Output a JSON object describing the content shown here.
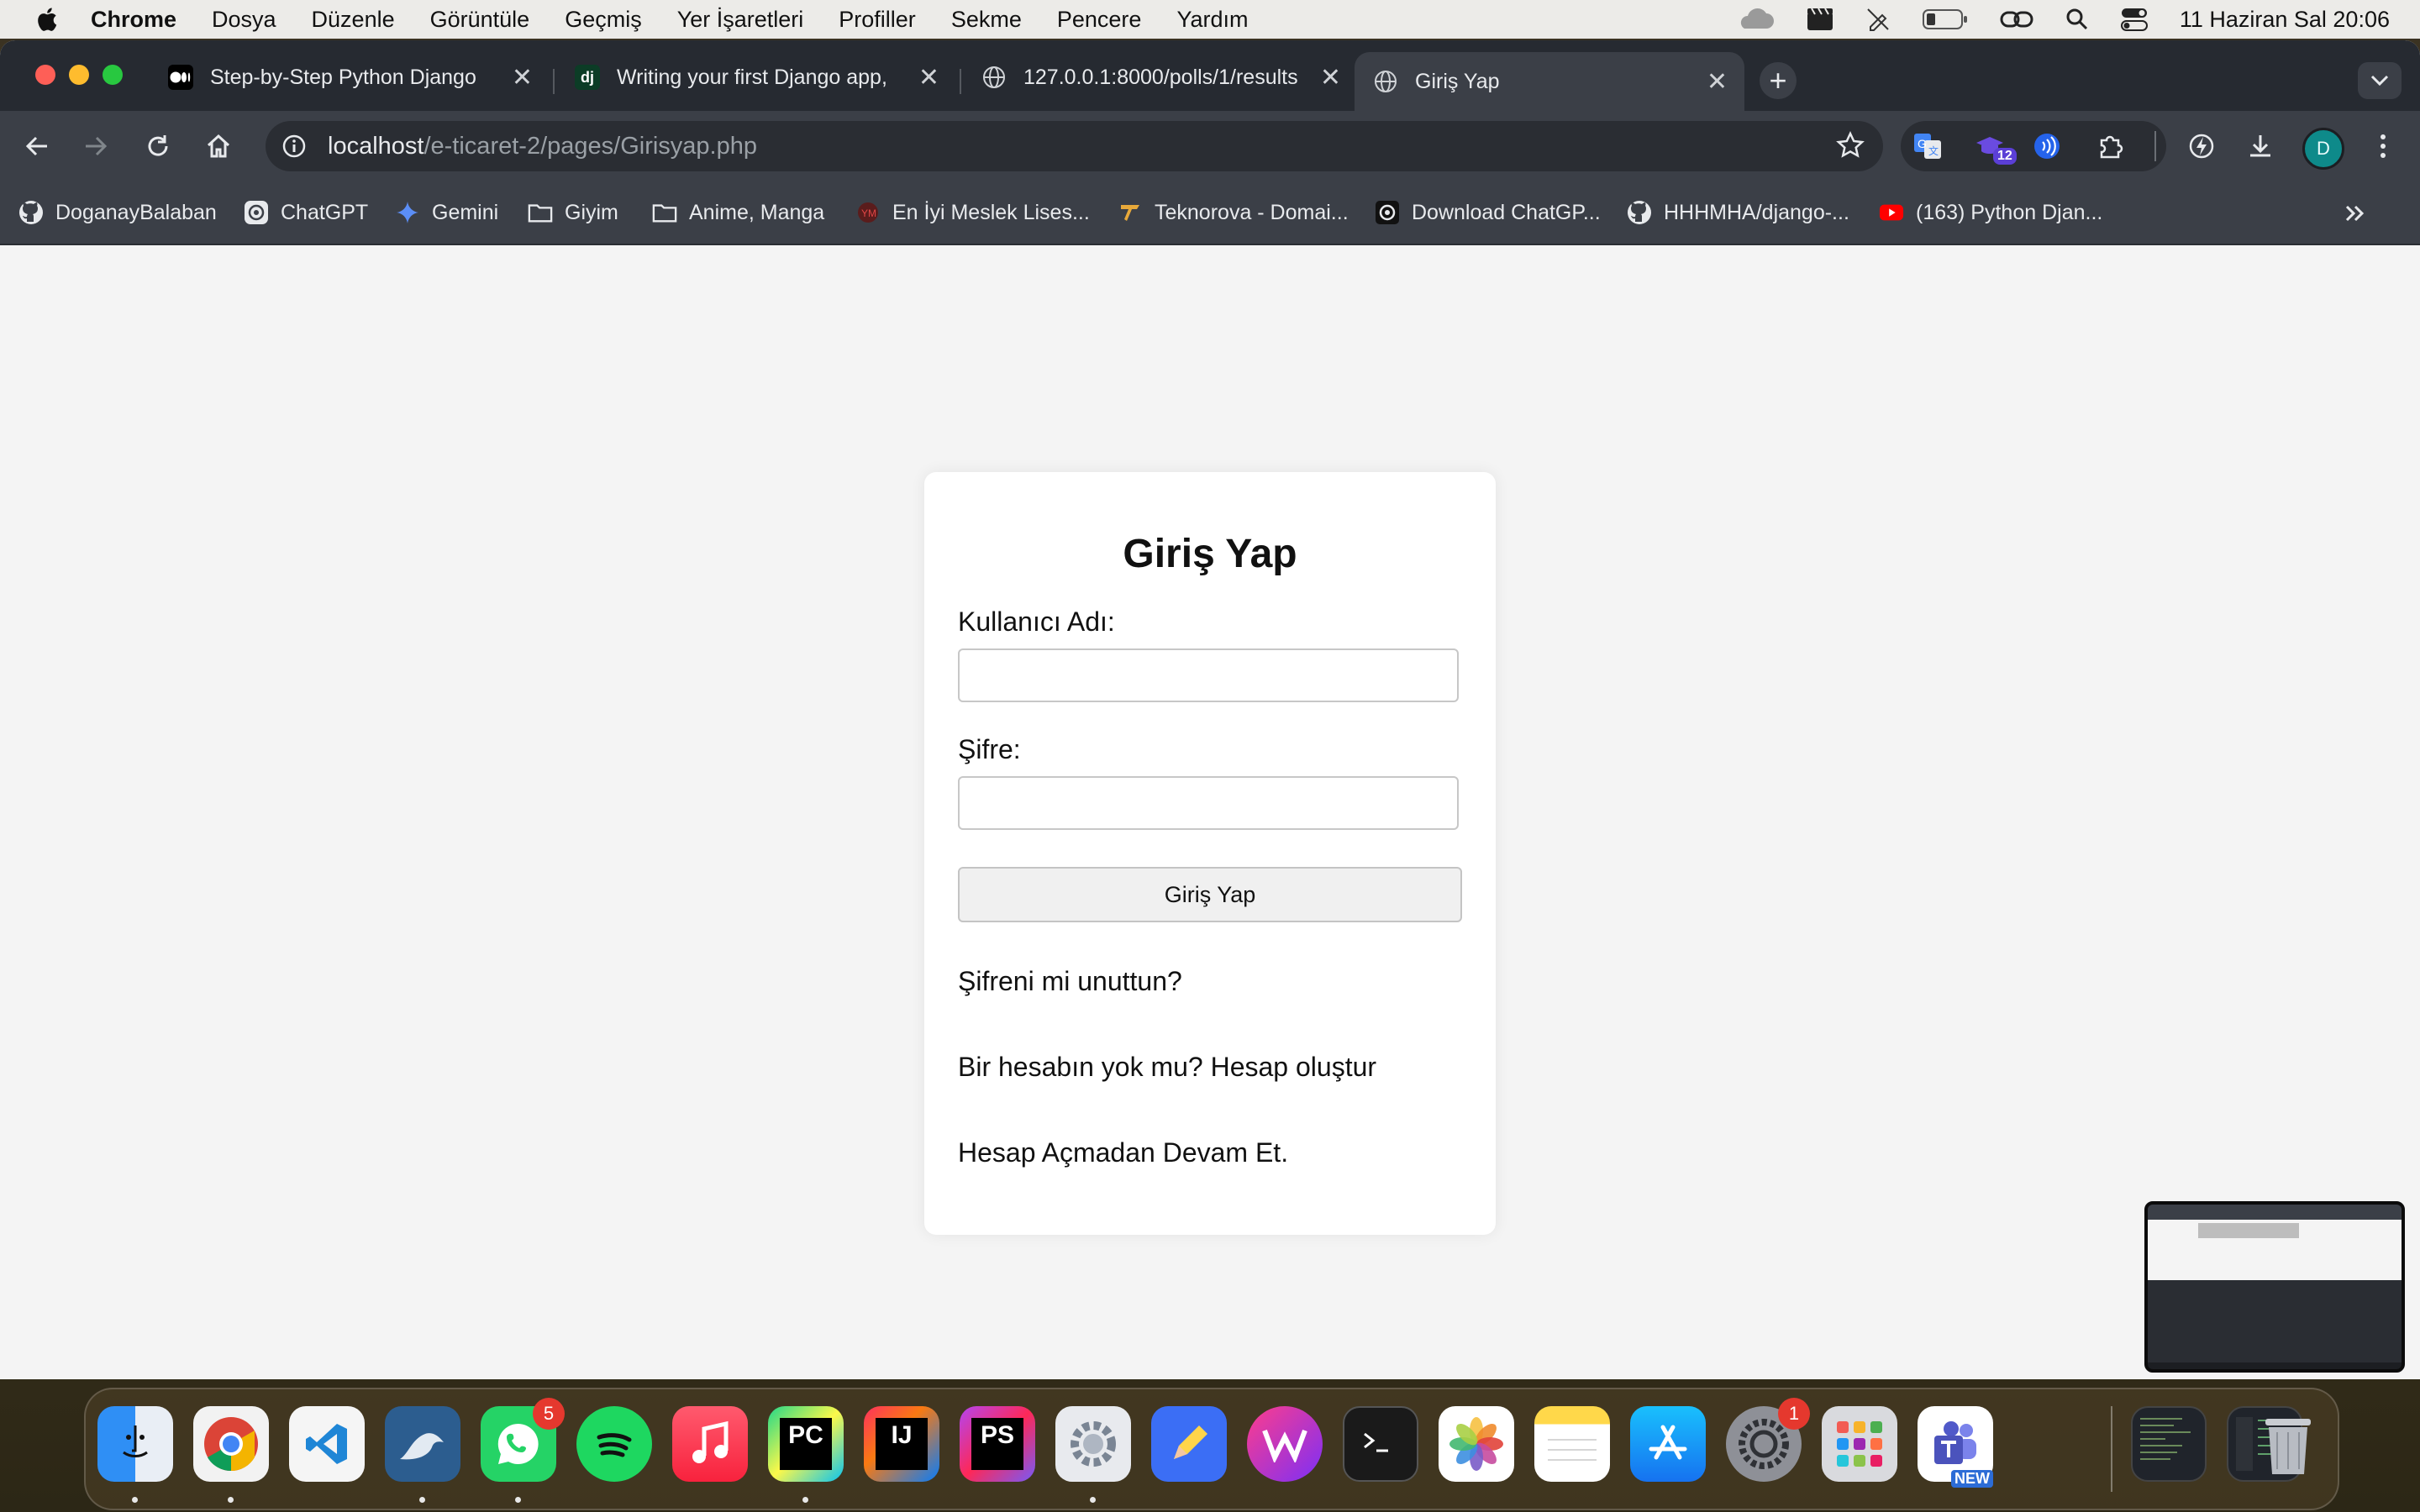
{
  "menubar": {
    "app_name": "Chrome",
    "items": [
      "Dosya",
      "Düzenle",
      "Görüntüle",
      "Geçmiş",
      "Yer İşaretleri",
      "Profiller",
      "Sekme",
      "Pencere",
      "Yardım"
    ],
    "clock": "11 Haziran Sal  20:06"
  },
  "tabs": [
    {
      "title": "Step-by-Step Python Django",
      "icon": "medium-icon"
    },
    {
      "title": "Writing your first Django app,",
      "icon": "django-icon"
    },
    {
      "title": "127.0.0.1:8000/polls/1/results",
      "icon": "globe-icon"
    },
    {
      "title": "Giriş Yap",
      "icon": "globe-icon",
      "active": true
    }
  ],
  "address": {
    "host": "localhost",
    "path": "/e-ticaret-2/pages/Girisyap.php"
  },
  "extensions": {
    "badge_count": "12",
    "avatar_letter": "D"
  },
  "bookmarks": [
    {
      "label": "DoganayBalaban",
      "icon": "github-icon"
    },
    {
      "label": "ChatGPT",
      "icon": "openai-icon"
    },
    {
      "label": "Gemini",
      "icon": "gemini-icon"
    },
    {
      "label": "Giyim",
      "icon": "folder-icon"
    },
    {
      "label": "Anime, Manga",
      "icon": "folder-icon"
    },
    {
      "label": "En İyi Meslek Lises...",
      "icon": "site-icon"
    },
    {
      "label": "Teknorova - Domai...",
      "icon": "teknorova-icon"
    },
    {
      "label": "Download ChatGP...",
      "icon": "openai-icon"
    },
    {
      "label": "HHHMHA/django-...",
      "icon": "github-icon"
    },
    {
      "label": "(163) Python Djan...",
      "icon": "youtube-icon"
    }
  ],
  "login": {
    "heading": "Giriş Yap",
    "username_label": "Kullanıcı Adı:",
    "username_value": "",
    "password_label": "Şifre:",
    "password_value": "",
    "submit_label": "Giriş Yap",
    "forgot_link": "Şifreni mi unuttun?",
    "signup_link": "Bir hesabın yok mu? Hesap oluştur",
    "guest_link": "Hesap Açmadan Devam Et."
  },
  "dock": {
    "whatsapp_badge": "5",
    "settings_badge": "1",
    "teams_tag": "NEW",
    "pycharm_label": "PC",
    "intellij_label": "IJ",
    "phpstorm_label": "PS"
  },
  "colors": {
    "page_bg": "#f4f4f4",
    "card_bg": "#ffffff",
    "chrome_dark": "#3b3f47",
    "tabstrip": "#262a31"
  }
}
